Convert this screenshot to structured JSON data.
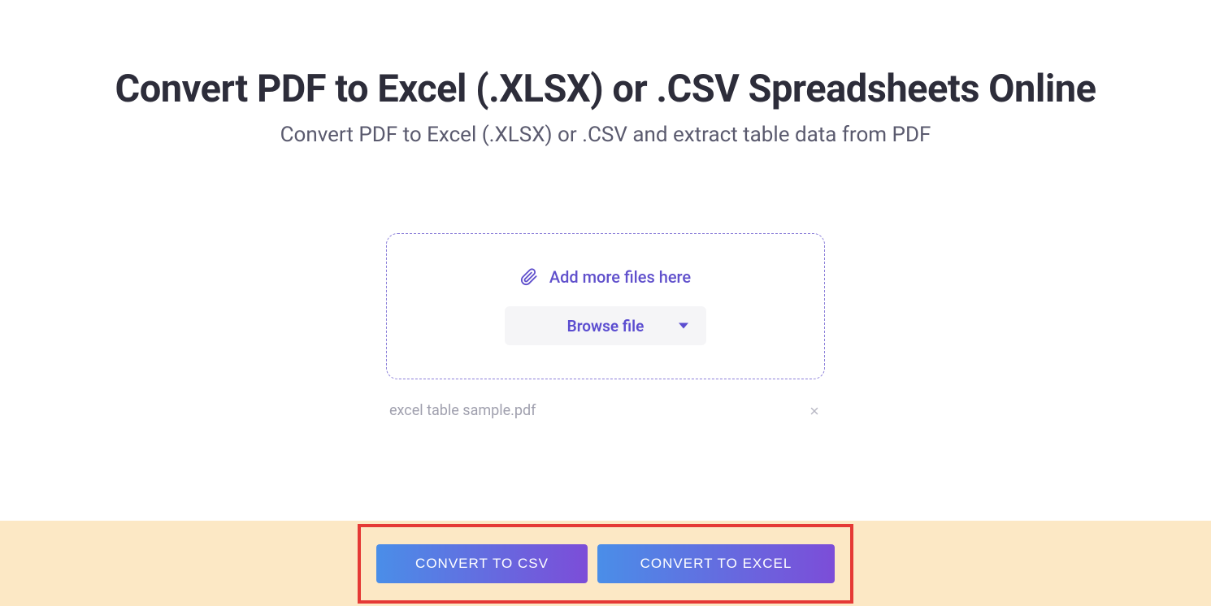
{
  "header": {
    "title": "Convert PDF to Excel (.XLSX) or .CSV Spreadsheets Online",
    "subtitle": "Convert PDF to Excel (.XLSX) or .CSV and extract table data from PDF"
  },
  "dropzone": {
    "add_files_label": "Add more files here",
    "browse_label": "Browse file"
  },
  "files": {
    "items": [
      {
        "name": "excel table sample.pdf"
      }
    ]
  },
  "actions": {
    "convert_csv_label": "CONVERT TO CSV",
    "convert_excel_label": "CONVERT TO EXCEL"
  }
}
